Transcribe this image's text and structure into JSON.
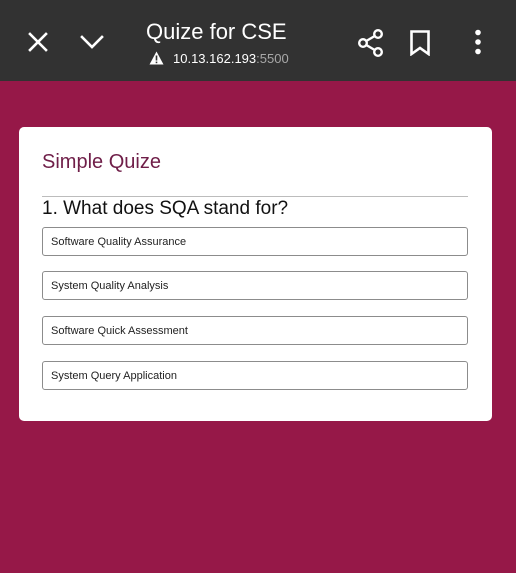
{
  "browser": {
    "page_title": "Quize for CSE",
    "url_host": "10.13.162.193",
    "url_port": ":5500",
    "icons": {
      "close": "close-icon",
      "collapse": "chevron-down-icon",
      "share": "share-icon",
      "bookmark": "bookmark-icon",
      "menu": "more-vertical-icon",
      "security": "warning-icon"
    },
    "colors": {
      "toolbar": "#323232",
      "page_background": "#961848"
    }
  },
  "quiz": {
    "heading": "Simple Quize",
    "question": "1. What does SQA stand for?",
    "options": [
      "Software Quality Assurance",
      "System Quality Analysis",
      "Software Quick Assessment",
      "System Query Application"
    ],
    "colors": {
      "heading": "#6f1e48"
    }
  }
}
